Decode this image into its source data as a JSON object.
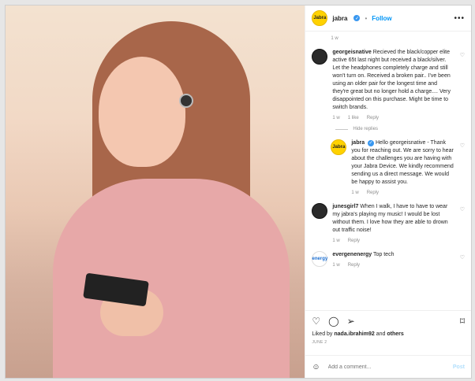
{
  "header": {
    "username": "jabra",
    "avatar_text": "Jabra",
    "follow": "Follow",
    "more": "•••"
  },
  "top_time": "1 w",
  "comments": [
    {
      "user": "georgeisnative",
      "text": "Recieved the black/copper elite active 65t last night but received a black/silver. Let the headphones completely charge and still won't turn on. Received a broken pair.. I've been using an older pair for the longest time and they're great but no longer hold a charge.... Very disappointed on this purchase. Might be time to switch brands.",
      "time": "1 w",
      "likes": "1 like",
      "reply": "Reply"
    }
  ],
  "hide_replies": "Hide replies",
  "brand_reply": {
    "user": "jabra",
    "avatar_text": "Jabra",
    "text": "Hello georgeisnative - Thank you for reaching out. We are sorry to hear about the challenges you are having with your Jabra Device. We kindly recommend sending us a direct message. We would be happy to assist you.",
    "time": "1 w",
    "reply": "Reply"
  },
  "comments2": [
    {
      "user": "junesgirl7",
      "text": "When I walk, I have to have to wear my jabra's playing my music! I would be lost without them. I love how they are able to drown out traffic noise!",
      "time": "1 w",
      "reply": "Reply"
    },
    {
      "user": "evergenenergy",
      "avatar_text": "energy",
      "text": "Top tech",
      "time": "1 w",
      "reply": "Reply"
    }
  ],
  "liked_by": {
    "prefix": "Liked by",
    "user": "nada.ibrahim92",
    "and": "and",
    "others": "others"
  },
  "date": "JUNE 2",
  "add_comment": {
    "placeholder": "Add a comment...",
    "post": "Post"
  },
  "colors": {
    "accent": "#0095f6",
    "jabra_yellow": "#ffd200"
  }
}
